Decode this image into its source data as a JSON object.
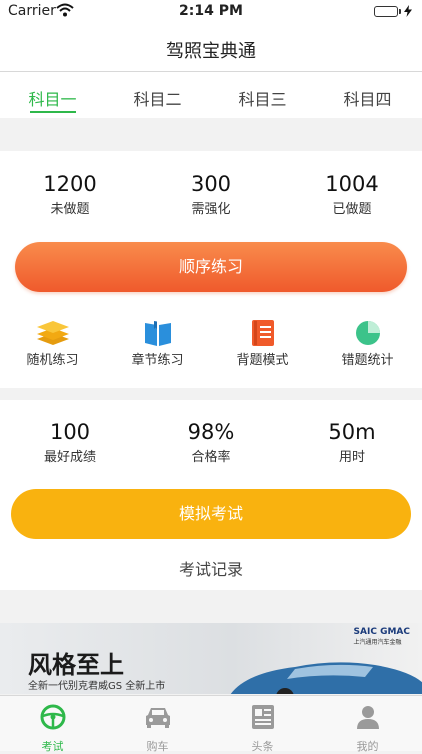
{
  "status_bar": {
    "carrier": "Carrier",
    "time": "2:14 PM"
  },
  "nav": {
    "title": "驾照宝典通"
  },
  "subject_tabs": [
    {
      "label": "科目一",
      "active": true
    },
    {
      "label": "科目二",
      "active": false
    },
    {
      "label": "科目三",
      "active": false
    },
    {
      "label": "科目四",
      "active": false
    }
  ],
  "practice_stats": [
    {
      "value": "1200",
      "label": "未做题"
    },
    {
      "value": "300",
      "label": "需强化"
    },
    {
      "value": "1004",
      "label": "已做题"
    }
  ],
  "order_practice_label": "顺序练习",
  "modes": [
    {
      "label": "随机练习",
      "icon": "layers-icon",
      "color": "#f5b417"
    },
    {
      "label": "章节练习",
      "icon": "book-icon",
      "color": "#2a8fdc"
    },
    {
      "label": "背题模式",
      "icon": "notebook-icon",
      "color": "#f05a2a"
    },
    {
      "label": "错题统计",
      "icon": "pie-chart-icon",
      "color": "#3cc38a"
    }
  ],
  "exam_stats": [
    {
      "value": "100",
      "label": "最好成绩"
    },
    {
      "value": "98%",
      "label": "合格率"
    },
    {
      "value": "50m",
      "label": "用时"
    }
  ],
  "mock_exam_label": "模拟考试",
  "exam_record_label": "考试记录",
  "banner": {
    "headline": "风格至上",
    "subline": "全新一代别克君威GS 全新上市",
    "brand": "SAIC GMAC",
    "brand_sub": "上汽通用汽车金融"
  },
  "tabbar": [
    {
      "label": "考试",
      "icon": "steering-wheel-icon",
      "active": true
    },
    {
      "label": "购车",
      "icon": "car-icon",
      "active": false
    },
    {
      "label": "头条",
      "icon": "newspaper-icon",
      "active": false
    },
    {
      "label": "我的",
      "icon": "person-icon",
      "active": false
    }
  ],
  "colors": {
    "accent": "#2eb84a",
    "order_button": "#ef5a2c",
    "mock_button": "#f9b20f"
  }
}
